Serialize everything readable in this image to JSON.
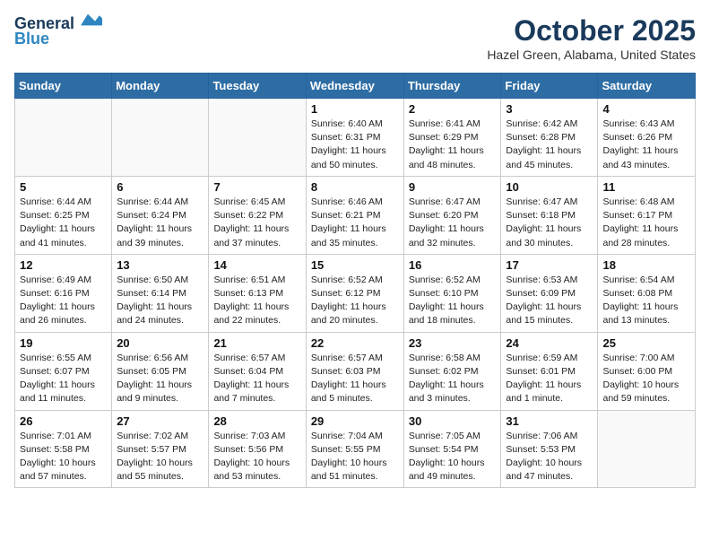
{
  "header": {
    "logo_line1": "General",
    "logo_line2": "Blue",
    "month": "October 2025",
    "location": "Hazel Green, Alabama, United States"
  },
  "weekdays": [
    "Sunday",
    "Monday",
    "Tuesday",
    "Wednesday",
    "Thursday",
    "Friday",
    "Saturday"
  ],
  "weeks": [
    [
      {
        "day": "",
        "info": ""
      },
      {
        "day": "",
        "info": ""
      },
      {
        "day": "",
        "info": ""
      },
      {
        "day": "1",
        "info": "Sunrise: 6:40 AM\nSunset: 6:31 PM\nDaylight: 11 hours\nand 50 minutes."
      },
      {
        "day": "2",
        "info": "Sunrise: 6:41 AM\nSunset: 6:29 PM\nDaylight: 11 hours\nand 48 minutes."
      },
      {
        "day": "3",
        "info": "Sunrise: 6:42 AM\nSunset: 6:28 PM\nDaylight: 11 hours\nand 45 minutes."
      },
      {
        "day": "4",
        "info": "Sunrise: 6:43 AM\nSunset: 6:26 PM\nDaylight: 11 hours\nand 43 minutes."
      }
    ],
    [
      {
        "day": "5",
        "info": "Sunrise: 6:44 AM\nSunset: 6:25 PM\nDaylight: 11 hours\nand 41 minutes."
      },
      {
        "day": "6",
        "info": "Sunrise: 6:44 AM\nSunset: 6:24 PM\nDaylight: 11 hours\nand 39 minutes."
      },
      {
        "day": "7",
        "info": "Sunrise: 6:45 AM\nSunset: 6:22 PM\nDaylight: 11 hours\nand 37 minutes."
      },
      {
        "day": "8",
        "info": "Sunrise: 6:46 AM\nSunset: 6:21 PM\nDaylight: 11 hours\nand 35 minutes."
      },
      {
        "day": "9",
        "info": "Sunrise: 6:47 AM\nSunset: 6:20 PM\nDaylight: 11 hours\nand 32 minutes."
      },
      {
        "day": "10",
        "info": "Sunrise: 6:47 AM\nSunset: 6:18 PM\nDaylight: 11 hours\nand 30 minutes."
      },
      {
        "day": "11",
        "info": "Sunrise: 6:48 AM\nSunset: 6:17 PM\nDaylight: 11 hours\nand 28 minutes."
      }
    ],
    [
      {
        "day": "12",
        "info": "Sunrise: 6:49 AM\nSunset: 6:16 PM\nDaylight: 11 hours\nand 26 minutes."
      },
      {
        "day": "13",
        "info": "Sunrise: 6:50 AM\nSunset: 6:14 PM\nDaylight: 11 hours\nand 24 minutes."
      },
      {
        "day": "14",
        "info": "Sunrise: 6:51 AM\nSunset: 6:13 PM\nDaylight: 11 hours\nand 22 minutes."
      },
      {
        "day": "15",
        "info": "Sunrise: 6:52 AM\nSunset: 6:12 PM\nDaylight: 11 hours\nand 20 minutes."
      },
      {
        "day": "16",
        "info": "Sunrise: 6:52 AM\nSunset: 6:10 PM\nDaylight: 11 hours\nand 18 minutes."
      },
      {
        "day": "17",
        "info": "Sunrise: 6:53 AM\nSunset: 6:09 PM\nDaylight: 11 hours\nand 15 minutes."
      },
      {
        "day": "18",
        "info": "Sunrise: 6:54 AM\nSunset: 6:08 PM\nDaylight: 11 hours\nand 13 minutes."
      }
    ],
    [
      {
        "day": "19",
        "info": "Sunrise: 6:55 AM\nSunset: 6:07 PM\nDaylight: 11 hours\nand 11 minutes."
      },
      {
        "day": "20",
        "info": "Sunrise: 6:56 AM\nSunset: 6:05 PM\nDaylight: 11 hours\nand 9 minutes."
      },
      {
        "day": "21",
        "info": "Sunrise: 6:57 AM\nSunset: 6:04 PM\nDaylight: 11 hours\nand 7 minutes."
      },
      {
        "day": "22",
        "info": "Sunrise: 6:57 AM\nSunset: 6:03 PM\nDaylight: 11 hours\nand 5 minutes."
      },
      {
        "day": "23",
        "info": "Sunrise: 6:58 AM\nSunset: 6:02 PM\nDaylight: 11 hours\nand 3 minutes."
      },
      {
        "day": "24",
        "info": "Sunrise: 6:59 AM\nSunset: 6:01 PM\nDaylight: 11 hours\nand 1 minute."
      },
      {
        "day": "25",
        "info": "Sunrise: 7:00 AM\nSunset: 6:00 PM\nDaylight: 10 hours\nand 59 minutes."
      }
    ],
    [
      {
        "day": "26",
        "info": "Sunrise: 7:01 AM\nSunset: 5:58 PM\nDaylight: 10 hours\nand 57 minutes."
      },
      {
        "day": "27",
        "info": "Sunrise: 7:02 AM\nSunset: 5:57 PM\nDaylight: 10 hours\nand 55 minutes."
      },
      {
        "day": "28",
        "info": "Sunrise: 7:03 AM\nSunset: 5:56 PM\nDaylight: 10 hours\nand 53 minutes."
      },
      {
        "day": "29",
        "info": "Sunrise: 7:04 AM\nSunset: 5:55 PM\nDaylight: 10 hours\nand 51 minutes."
      },
      {
        "day": "30",
        "info": "Sunrise: 7:05 AM\nSunset: 5:54 PM\nDaylight: 10 hours\nand 49 minutes."
      },
      {
        "day": "31",
        "info": "Sunrise: 7:06 AM\nSunset: 5:53 PM\nDaylight: 10 hours\nand 47 minutes."
      },
      {
        "day": "",
        "info": ""
      }
    ]
  ]
}
